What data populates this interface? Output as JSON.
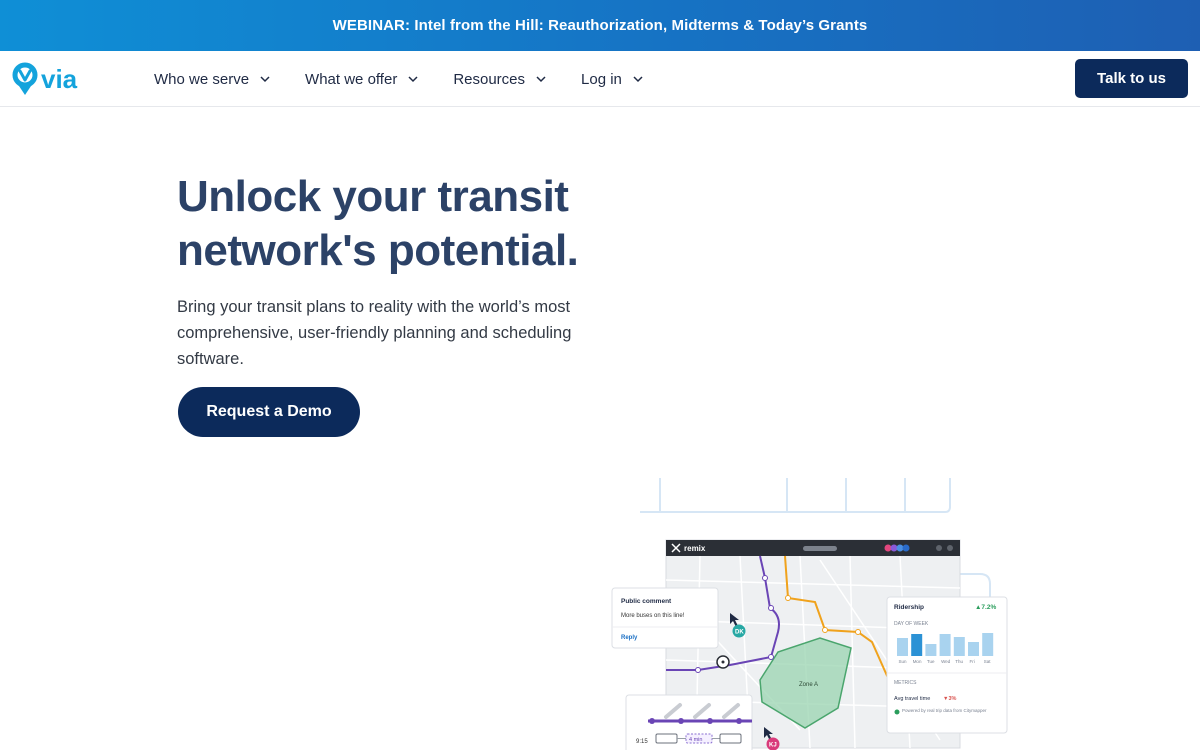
{
  "banner": {
    "text": "WEBINAR: Intel from the Hill: Reauthorization, Midterms & Today’s Grants"
  },
  "nav": {
    "logo_text": "via",
    "items": [
      {
        "label": "Who we serve"
      },
      {
        "label": "What we offer"
      },
      {
        "label": "Resources"
      },
      {
        "label": "Log in"
      }
    ],
    "cta_label": "Talk to us"
  },
  "hero": {
    "title_line1": "Unlock your transit",
    "title_line2": "network's potential.",
    "subtitle": "Bring your transit plans to reality with the world’s most comprehensive, user-friendly planning and scheduling software.",
    "button_label": "Request a Demo"
  },
  "illustration": {
    "app_name": "remix",
    "comment_title": "Public comment",
    "comment_text": "More buses on this line!",
    "comment_reply": "Reply",
    "avatar1": "DK",
    "avatar2": "KJ",
    "zone_label": "Zone A",
    "ridership_title": "Ridership",
    "ridership_change": "▲7.2%",
    "day_of_week_label": "DAY OF WEEK",
    "days": [
      "Sun",
      "Mon",
      "Tue",
      "Wed",
      "Thu",
      "Fri",
      "Sat"
    ],
    "metrics_label": "METRICS",
    "metric_name": "Avg travel time",
    "metric_change": "▼3%",
    "powered_by": "Powered by real trip data from Citymapper",
    "schedule_time": "9:15",
    "schedule_gap": "4 min"
  },
  "colors": {
    "banner": "#1673c4",
    "navy": "#0c2a5b",
    "title": "#2c4267",
    "logo": "#14a3dc",
    "route_purple": "#6a45b5",
    "route_orange": "#f0a21c",
    "zone_green": "#8fd1a6"
  }
}
